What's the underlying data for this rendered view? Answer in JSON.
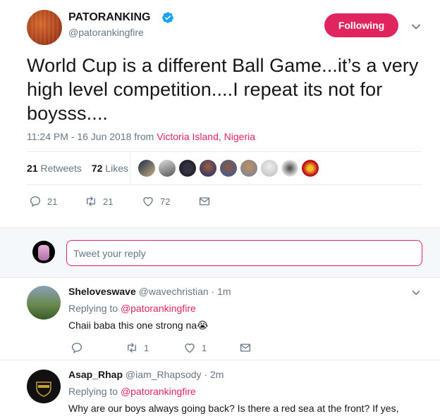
{
  "tweet": {
    "display_name": "PATORANKING",
    "handle": "@patorankingfire",
    "follow_label": "Following",
    "text": "World Cup is a different Ball Game...it’s a very high level competition....I repeat its not for boysss....",
    "timestamp": "11:24 PM - 16 Jun 2018 from ",
    "location": "Victoria Island, Nigeria",
    "retweets_count": "21",
    "retweets_label": "Retweets",
    "likes_count": "72",
    "likes_label": "Likes",
    "actions": {
      "reply_count": "21",
      "retweet_count": "21",
      "like_count": "72"
    }
  },
  "reply_box": {
    "placeholder": "Tweet your reply"
  },
  "replies": [
    {
      "name": "Sheloveswave",
      "handle": "@wavechristian · 1m",
      "replying_prefix": "Replying to ",
      "replying_to": "@patorankingfire",
      "text": "Chaii baba this one strong na😭",
      "retweet_count": "1",
      "like_count": "1"
    },
    {
      "name": "Asap_Rhap",
      "handle": "@iam_Rhapsody · 2m",
      "replying_prefix": "Replying to ",
      "replying_to": "@patorankingfire",
      "text": "Why are our boys always going back? Is there a red sea at the front? If yes,"
    }
  ],
  "colors": {
    "accent": "#e0245e",
    "verified": "#1da1f2",
    "muted": "#657786"
  }
}
